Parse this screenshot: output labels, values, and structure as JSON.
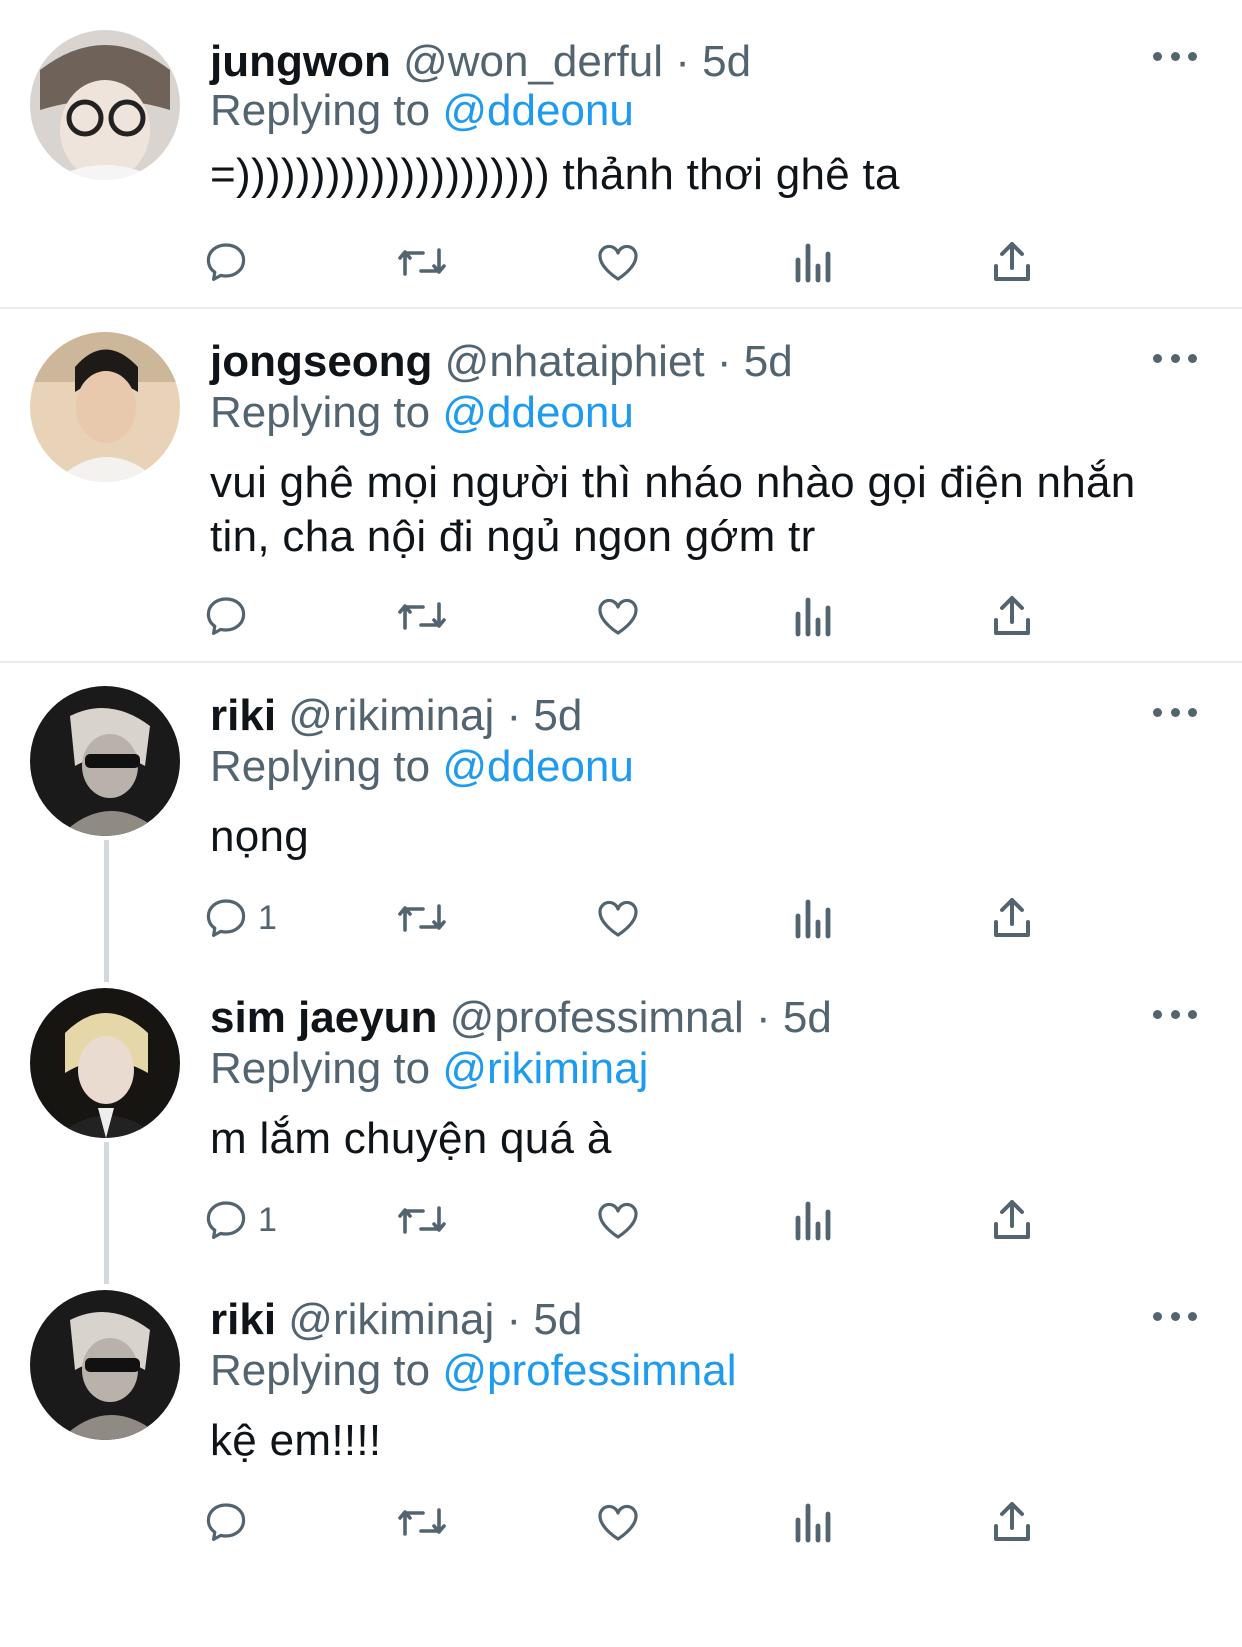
{
  "tweets": [
    {
      "name": "jungwon",
      "handle": "@won_derful",
      "dot": "·",
      "time": "5d",
      "replying_prefix": "Replying to",
      "replying_to": "@ddeonu",
      "text": "=))))))))))))))))))))) thảnh thơi ghê ta",
      "reply_count": ""
    },
    {
      "name": "jongseong",
      "handle": "@nhataiphiet",
      "dot": "·",
      "time": "5d",
      "replying_prefix": "Replying to",
      "replying_to": "@ddeonu",
      "text": "vui ghê mọi người thì nháo nhào gọi điện nhắn tin, cha nội đi ngủ ngon gớm tr",
      "reply_count": ""
    },
    {
      "name": "riki",
      "handle": "@rikiminaj",
      "dot": "·",
      "time": "5d",
      "replying_prefix": "Replying to",
      "replying_to": "@ddeonu",
      "text": "nọng",
      "reply_count": "1"
    },
    {
      "name": "sim jaeyun",
      "handle": "@professimnal",
      "dot": "·",
      "time": "5d",
      "replying_prefix": "Replying to",
      "replying_to": "@rikiminaj",
      "text": "m lắm chuyện quá à",
      "reply_count": "1"
    },
    {
      "name": "riki",
      "handle": "@rikiminaj",
      "dot": "·",
      "time": "5d",
      "replying_prefix": "Replying to",
      "replying_to": "@professimnal",
      "text": "kệ em!!!!",
      "reply_count": ""
    }
  ],
  "icons": {
    "reply": "reply-icon",
    "retweet": "retweet-icon",
    "like": "heart-icon",
    "views": "views-icon",
    "share": "share-icon",
    "more": "more-icon"
  },
  "colors": {
    "text": "#0f1419",
    "secondary": "#536471",
    "link": "#1d9bf0",
    "divider": "#e6ecf0"
  }
}
